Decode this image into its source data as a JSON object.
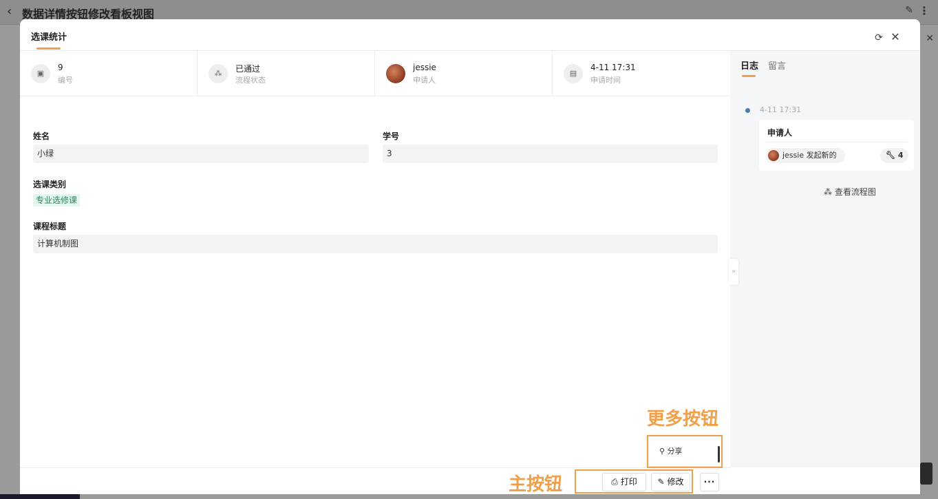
{
  "background": {
    "title": "数据详情按钮修改看板视图"
  },
  "modal": {
    "title": "选课统计"
  },
  "info_strip": [
    {
      "value": "9",
      "label": "编号",
      "icon": "id-card-icon"
    },
    {
      "value": "已通过",
      "label": "流程状态",
      "icon": "flow-icon"
    },
    {
      "value": "jessie",
      "label": "申请人",
      "icon": "avatar"
    },
    {
      "value": "4-11 17:31",
      "label": "申请时间",
      "icon": "calendar-icon"
    }
  ],
  "form": {
    "name_label": "姓名",
    "name_value": "小绿",
    "student_id_label": "学号",
    "student_id_value": "3",
    "course_type_label": "选课类别",
    "course_type_value": "专业选修课",
    "course_title_label": "课程标题",
    "course_title_value": "计算机制图"
  },
  "side": {
    "tab_log": "日志",
    "tab_message": "留言",
    "log_time": "4-11 17:31",
    "log_title": "申请人",
    "log_user": "jessie 发起新的",
    "log_count": "4",
    "flowchart_link": "查看流程图"
  },
  "footer": {
    "print_label": "打印",
    "edit_label": "修改",
    "more_label": "···"
  },
  "dropdown": {
    "share_label": "分享"
  },
  "annotations": {
    "more_buttons": "更多按钮",
    "main_buttons": "主按钮"
  },
  "colors": {
    "accent": "#f0a04b",
    "tag_green_bg": "#e4f6ef",
    "tag_green_text": "#2a8b5a",
    "timeline_dot": "#4a7bb7"
  }
}
